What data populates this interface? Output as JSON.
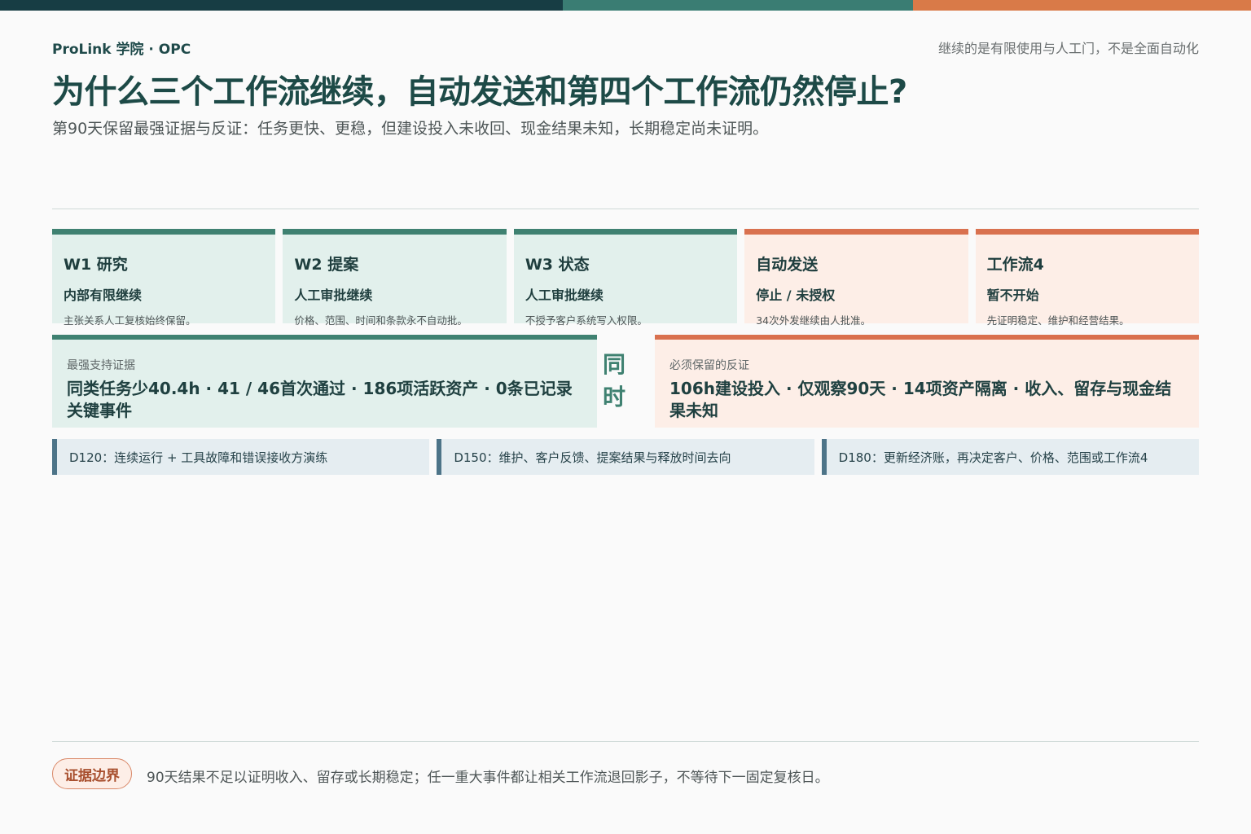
{
  "header": {
    "brand": "ProLink 学院 · OPC",
    "tagline": "继续的是有限使用与人工门，不是全面自动化",
    "title": "为什么三个工作流继续，自动发送和第四个工作流仍然停止?",
    "subtitle": "第90天保留最强证据与反证：任务更快、更稳，但建设投入未收回、现金结果未知，长期稳定尚未证明。"
  },
  "colors": {
    "accent_dark": "#173d44",
    "accent_green": "#3f8171",
    "accent_orange": "#d9714f",
    "accent_steel": "#4d7488"
  },
  "cards": [
    {
      "title": "W1 研究",
      "status": "内部有限继续",
      "note": "主张关系人工复核始终保留。"
    },
    {
      "title": "W2 提案",
      "status": "人工审批继续",
      "note": "价格、范围、时间和条款永不自动批。"
    },
    {
      "title": "W3 状态",
      "status": "人工审批继续",
      "note": "不授予客户系统写入权限。"
    },
    {
      "title": "自动发送",
      "status": "停止 / 未授权",
      "note": "34次外发继续由人批准。"
    },
    {
      "title": "工作流4",
      "status": "暂不开始",
      "note": "先证明稳定、维护和经营结果。"
    }
  ],
  "evidence": {
    "support_label": "最强支持证据",
    "support_body": "同类任务少40.4h · 41 / 46首次通过 · 186项活跃资产 · 0条已记录关键事件",
    "simultaneous_1": "同",
    "simultaneous_2": "时",
    "counter_label": "必须保留的反证",
    "counter_body": "106h建设投入 · 仅观察90天 · 14项资产隔离 · 收入、留存与现金结果未知"
  },
  "milestones": [
    {
      "text": "D120：连续运行 + 工具故障和错误接收方演练"
    },
    {
      "text": "D150：维护、客户反馈、提案结果与释放时间去向"
    },
    {
      "text": "D180：更新经济账，再决定客户、价格、范围或工作流4"
    }
  ],
  "footer": {
    "badge": "证据边界",
    "text": "90天结果不足以证明收入、留存或长期稳定；任一重大事件都让相关工作流退回影子，不等待下一固定复核日。"
  }
}
